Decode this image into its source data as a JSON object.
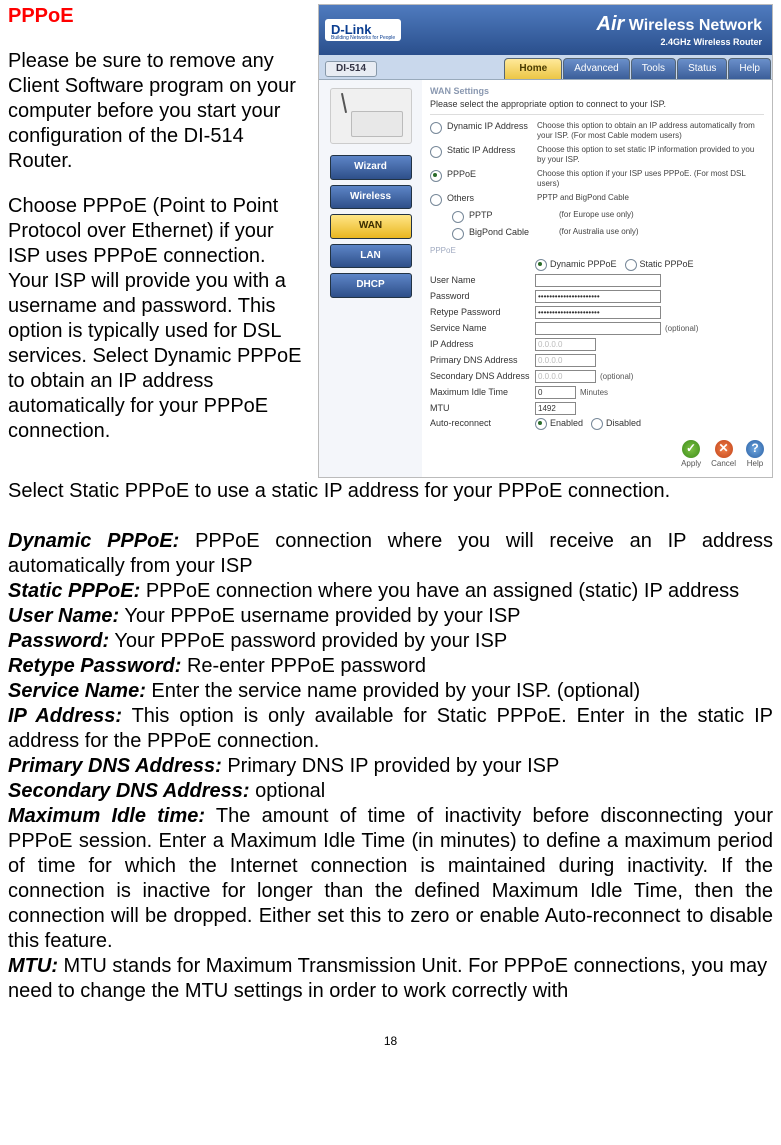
{
  "title": "PPPoE",
  "intro1": "Please be sure to remove any Client Software program on your computer before you start your configuration of the DI-514 Router.",
  "intro2": "Choose PPPoE (Point to Point Protocol over Ethernet) if your ISP uses PPPoE connection. Your ISP will provide you with a username and password. This option is typically used for DSL services. Select Dynamic PPPoE to obtain an IP address automatically for your PPPoE connection.",
  "intro3": "Select Static PPPoE to use a static IP address for your PPPoE connection.",
  "defs": {
    "dynamic_pppoe_label": "Dynamic PPPoE:",
    "dynamic_pppoe_text": " PPPoE connection where you will receive an IP address automatically from your ISP",
    "static_pppoe_label": "Static PPPoE:",
    "static_pppoe_text": " PPPoE connection where you have an assigned (static) IP address",
    "user_name_label": "User Name:",
    "user_name_text": " Your PPPoE username provided by your ISP",
    "password_label": "Password:",
    "password_text": " Your PPPoE password provided by your ISP",
    "retype_label": "Retype Password:",
    "retype_text": " Re-enter PPPoE password",
    "service_label": "Service Name:",
    "service_text": " Enter the service name provided by your ISP. (optional)",
    "ip_label": "IP Address:",
    "ip_text": " This option is only available for Static PPPoE. Enter in the static IP address for the PPPoE connection.",
    "pdns_label": "Primary DNS Address:",
    "pdns_text": " Primary DNS IP provided by your ISP",
    "sdns_label": "Secondary DNS Address:",
    "sdns_text": " optional",
    "idle_label": "Maximum Idle time:",
    "idle_text": " The amount of time of inactivity before disconnecting your PPPoE session. Enter a Maximum Idle Time (in minutes) to define a maximum period of time for which the Internet connection is maintained during inactivity. If the connection is inactive for longer than the defined Maximum Idle Time, then the connection will be dropped. Either set this to zero or enable Auto-reconnect to disable this feature.",
    "mtu_label": "MTU:",
    "mtu_text": " MTU stands for Maximum Transmission Unit. For PPPoE connections, you may need to change the MTU settings in order to work correctly with"
  },
  "page_number": "18",
  "router": {
    "logo": "D-Link",
    "logo_sub": "Building Networks for People",
    "air": "Air",
    "wireless": " Wireless Network",
    "air_sub": "2.4GHz Wireless Router",
    "model": "DI-514",
    "tabs": {
      "home": "Home",
      "advanced": "Advanced",
      "tools": "Tools",
      "status": "Status",
      "help": "Help"
    },
    "sidebar": {
      "wizard": "Wizard",
      "wireless": "Wireless",
      "wan": "WAN",
      "lan": "LAN",
      "dhcp": "DHCP"
    },
    "section_title": "WAN Settings",
    "section_sub": "Please select the appropriate option to connect to your ISP.",
    "options": {
      "dynamic_ip": "Dynamic IP Address",
      "dynamic_ip_desc": "Choose this option to obtain an IP address automatically from your ISP. (For most Cable modem users)",
      "static_ip": "Static IP Address",
      "static_ip_desc": "Choose this option to set static IP information provided to you by your ISP.",
      "pppoe": "PPPoE",
      "pppoe_desc": "Choose this option if your ISP uses PPPoE. (For most DSL users)",
      "others": "Others",
      "others_desc": "PPTP and BigPond Cable",
      "pptp": "PPTP",
      "pptp_desc": "(for Europe use only)",
      "bigpond": "BigPond Cable",
      "bigpond_desc": "(for Australia use only)"
    },
    "pppoe_section_label": "PPPoE",
    "pppoe_mode": {
      "dynamic": "Dynamic PPPoE",
      "static": "Static PPPoE"
    },
    "fields": {
      "user_name": "User Name",
      "password": "Password",
      "password_val": "••••••••••••••••••••••",
      "retype": "Retype Password",
      "retype_val": "••••••••••••••••••••••",
      "service": "Service Name",
      "optional": "(optional)",
      "ip": "IP Address",
      "ip_val": "0.0.0.0",
      "pdns": "Primary DNS Address",
      "pdns_val": "0.0.0.0",
      "sdns": "Secondary DNS Address",
      "sdns_val": "0.0.0.0",
      "idle": "Maximum Idle Time",
      "idle_val": "0",
      "idle_unit": "Minutes",
      "mtu": "MTU",
      "mtu_val": "1492",
      "auto": "Auto-reconnect",
      "enabled": "Enabled",
      "disabled": "Disabled"
    },
    "actions": {
      "apply": "Apply",
      "cancel": "Cancel",
      "help": "Help"
    }
  }
}
